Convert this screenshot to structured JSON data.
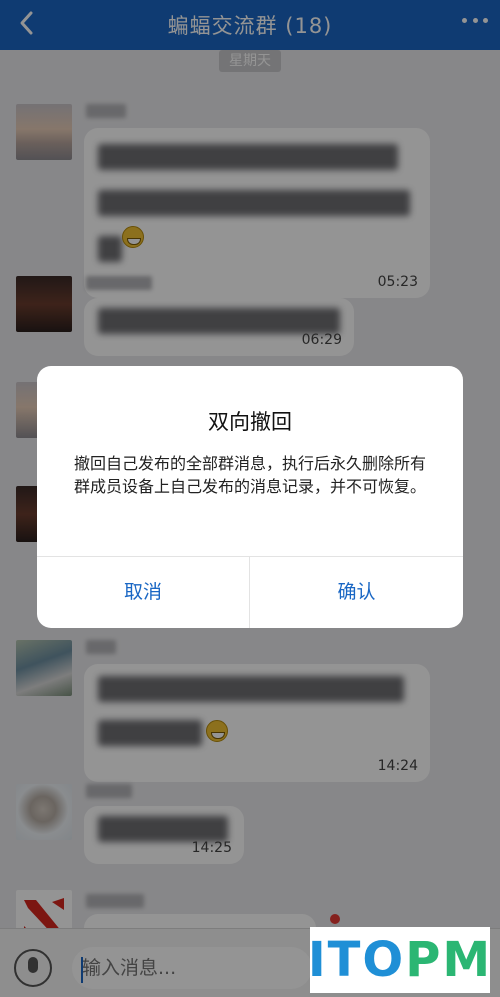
{
  "header": {
    "title": "蝙蝠交流群 (18)",
    "back_icon": "chevron-left-icon",
    "more_icon": "more-dots-icon"
  },
  "chat": {
    "day_label": "星期天",
    "messages": [
      {
        "time": "05:23",
        "has_emoji": true
      },
      {
        "time": "06:29"
      },
      {
        "time": ""
      },
      {
        "time": ""
      },
      {
        "time": "14:24",
        "has_emoji": true
      },
      {
        "time": "14:25"
      },
      {
        "time": ""
      }
    ]
  },
  "dialog": {
    "title": "双向撤回",
    "body": "撤回自己发布的全部群消息，执行后永久删除所有群成员设备上自己发布的消息记录，并不可恢复。",
    "cancel_label": "取消",
    "confirm_label": "确认"
  },
  "input": {
    "placeholder": "输入消息...",
    "mic_icon": "microphone-icon"
  },
  "watermark": {
    "text": "ITOPM"
  },
  "colors": {
    "brand": "#1a67c4",
    "watermark_a": "#1f8fd6",
    "watermark_b": "#2bb673"
  }
}
